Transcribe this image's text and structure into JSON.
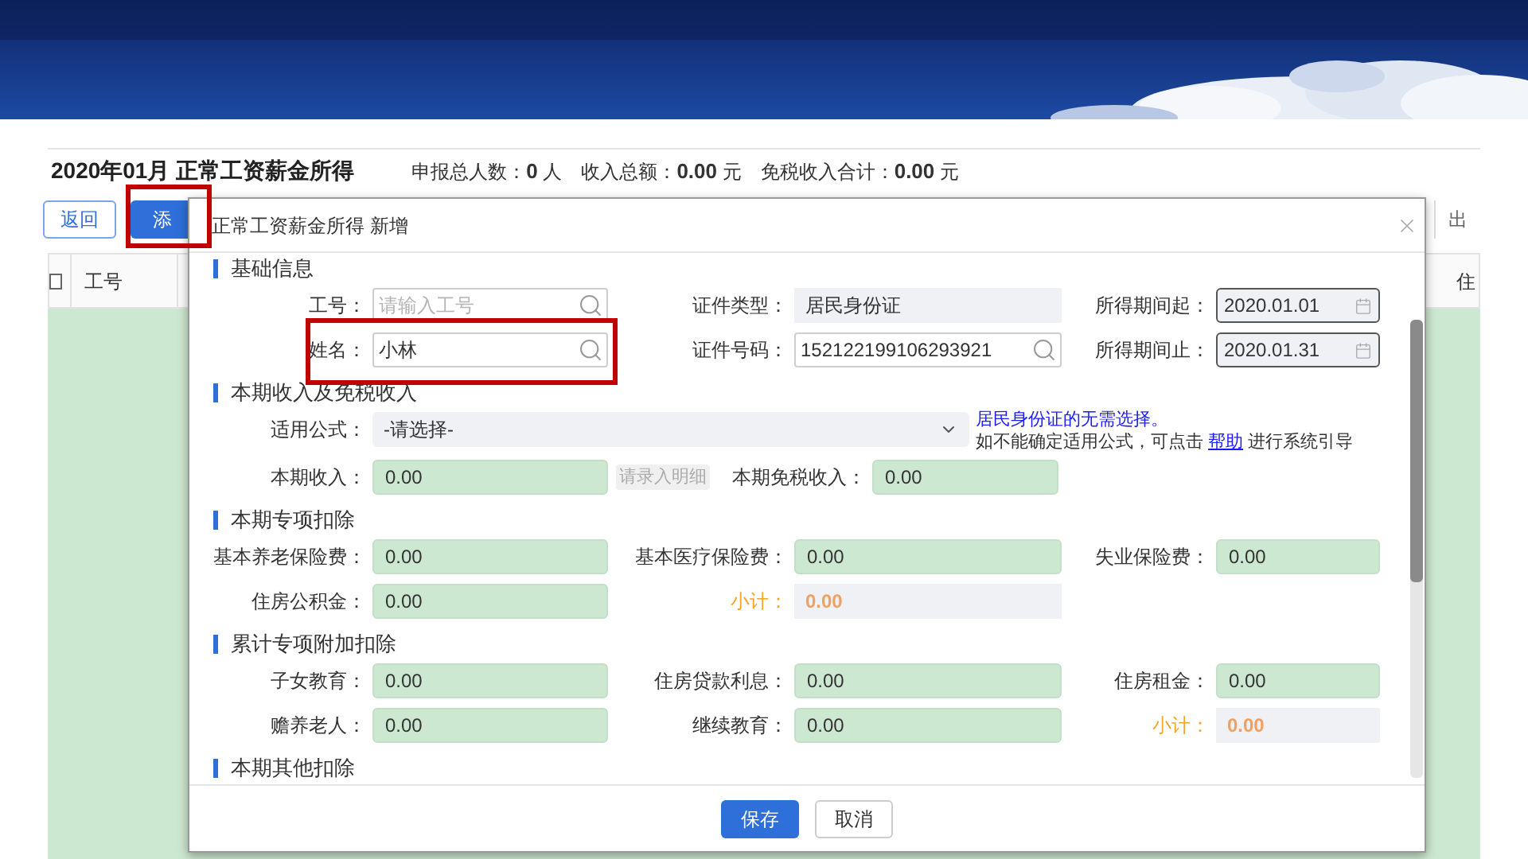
{
  "header": {
    "title": "2020年01月 正常工资薪金所得",
    "stats": [
      {
        "label": "申报总人数：",
        "value": "0",
        "unit": "人"
      },
      {
        "label": "收入总额：",
        "value": "0.00",
        "unit": "元"
      },
      {
        "label": "免税收入合计：",
        "value": "0.00",
        "unit": "元"
      }
    ]
  },
  "toolbar": {
    "buttons": [
      {
        "label": "返回",
        "kind": "outline",
        "highlighted": false
      },
      {
        "label": "添",
        "kind": "primary",
        "highlighted": true
      }
    ],
    "right_label": "出"
  },
  "table": {
    "columns": [
      {
        "kind": "checkbox",
        "checked": false
      },
      {
        "kind": "text",
        "label": "工号"
      },
      {
        "kind": "text",
        "label": "住"
      }
    ]
  },
  "dialog": {
    "title": "正常工资薪金所得 新增",
    "sections": [
      {
        "title": "基础信息",
        "rows": [
          {
            "kind": "fields",
            "fields": [
              {
                "label": "工号：",
                "kind": "search",
                "placeholder": "请输入工号",
                "highlighted": false
              },
              {
                "label": "证件类型：",
                "kind": "readonly",
                "value": "居民身份证"
              },
              {
                "label": "所得期间起：",
                "kind": "date",
                "value": "2020.01.01"
              }
            ]
          },
          {
            "kind": "fields",
            "fields": [
              {
                "label": "姓名：",
                "kind": "search",
                "value": "小林",
                "highlighted": true
              },
              {
                "label": "证件号码：",
                "kind": "search",
                "value": "152122199106293921",
                "highlighted": false
              },
              {
                "label": "所得期间止：",
                "kind": "date",
                "value": "2020.01.31"
              }
            ]
          }
        ]
      },
      {
        "title": "本期收入及免税收入",
        "rows": [
          {
            "kind": "select",
            "label": "适用公式：",
            "value": "-请选择-",
            "note": "居民身份证的无需选择。",
            "hint": {
              "before": "如不能确定适用公式，可点击 ",
              "link": "帮助",
              "after": " 进行系统引导"
            }
          },
          {
            "kind": "income",
            "label": "本期收入：",
            "value": "0.00",
            "detail_button": {
              "label": "请录入明细",
              "disabled": true
            },
            "extra_label": "本期免税收入：",
            "extra_value": "0.00"
          }
        ]
      },
      {
        "title": "本期专项扣除",
        "rows": [
          {
            "kind": "fields",
            "fields": [
              {
                "label": "基本养老保险费：",
                "kind": "amount",
                "value": "0.00"
              },
              {
                "label": "基本医疗保险费：",
                "kind": "amount",
                "value": "0.00"
              },
              {
                "label": "失业保险费：",
                "kind": "amount",
                "value": "0.00"
              }
            ]
          },
          {
            "kind": "fields",
            "fields": [
              {
                "label": "住房公积金：",
                "kind": "amount",
                "value": "0.00"
              },
              {
                "label": "小计：",
                "kind": "subtotal",
                "value": "0.00"
              }
            ]
          }
        ]
      },
      {
        "title": "累计专项附加扣除",
        "rows": [
          {
            "kind": "fields",
            "fields": [
              {
                "label": "子女教育：",
                "kind": "amount",
                "value": "0.00"
              },
              {
                "label": "住房贷款利息：",
                "kind": "amount",
                "value": "0.00"
              },
              {
                "label": "住房租金：",
                "kind": "amount",
                "value": "0.00"
              }
            ]
          },
          {
            "kind": "fields",
            "fields": [
              {
                "label": "赡养老人：",
                "kind": "amount",
                "value": "0.00"
              },
              {
                "label": "继续教育：",
                "kind": "amount",
                "value": "0.00"
              },
              {
                "label": "小计：",
                "kind": "subtotal",
                "value": "0.00"
              }
            ]
          }
        ]
      },
      {
        "title": "本期其他扣除"
      }
    ],
    "buttons": [
      {
        "label": "保存",
        "kind": "primary"
      },
      {
        "label": "取消",
        "kind": "default"
      }
    ]
  }
}
